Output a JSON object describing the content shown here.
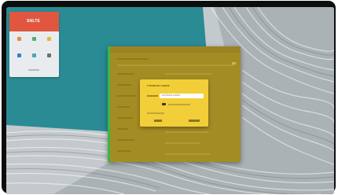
{
  "widget": {
    "title": "SNLTE",
    "icon_names": [
      "gear-icon",
      "list-icon",
      "star-icon",
      "share-icon",
      "chart-icon",
      "globe-icon"
    ],
    "icon_colors": [
      "#e58b3d",
      "#4fb071",
      "#e8b63a",
      "#3e7bd1",
      "#47a6b8",
      "#6c6f73"
    ]
  },
  "dialog": {
    "title": "UTBRDOR GSBRF",
    "input_value": "SPSTBRDF ENSRB"
  },
  "colors": {
    "accent_header": "#e0563e",
    "window": "#a38c24",
    "window_border": "#35b84a",
    "dialog": "#f2cf38",
    "wallpaper": "#2a8a93"
  }
}
